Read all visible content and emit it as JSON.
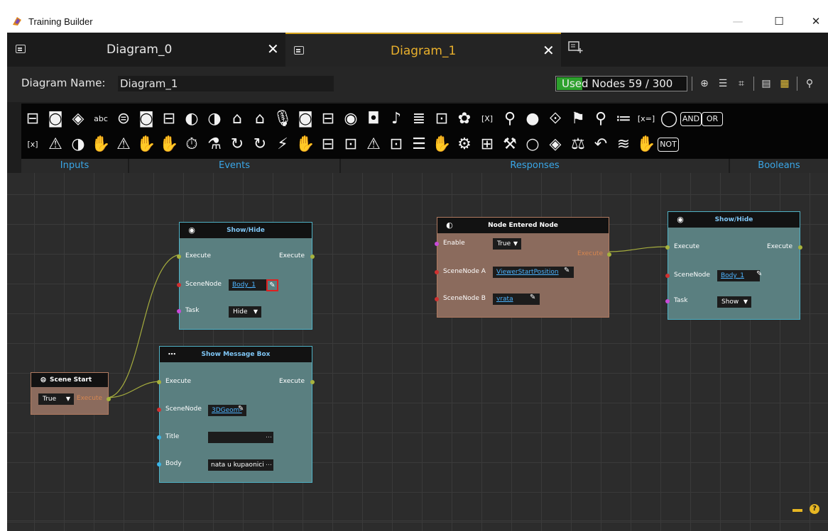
{
  "window": {
    "title": "Training Builder",
    "controls": {
      "minimize": "—",
      "maximize": "☐",
      "close": "✕"
    }
  },
  "tabs": [
    {
      "label": "Diagram_0",
      "close": "✕",
      "active": false
    },
    {
      "label": "Diagram_1",
      "close": "✕",
      "active": true
    }
  ],
  "namebar": {
    "label": "Diagram Name:",
    "value": "Diagram_1",
    "used_nodes": "Used Nodes 59 / 300",
    "used_fraction": 0.197
  },
  "palette": {
    "row1": [
      "⊟",
      "◙",
      "◈",
      "abc",
      "⊜",
      "◙",
      "⊟",
      "◐",
      "◑",
      "⌂",
      "⌂",
      "🎙",
      "◙",
      "⊟",
      "◉",
      "◘",
      "♪",
      "≣",
      "⊡",
      "✿",
      "[X]",
      "⚲",
      "●",
      "⟐",
      "⚑",
      "⚲",
      "≔",
      "[x=]",
      "◯",
      "AND",
      "OR"
    ],
    "row2": [
      "[x]",
      "⚠",
      "◑",
      "✋",
      "⚠",
      "✋",
      "✋",
      "⏱",
      "⚗",
      "↻",
      "↻",
      "⚡",
      "✋",
      "⊟",
      "⊡",
      "⚠",
      "⊡",
      "☰",
      "✋",
      "⚙",
      "⊞",
      "⚒",
      "○",
      "◈",
      "⚖",
      "↶",
      "≋",
      "✋",
      "NOT"
    ],
    "sections": {
      "inputs": "Inputs",
      "events": "Events",
      "responses": "Responses",
      "booleans": "Booleans"
    }
  },
  "nodes": {
    "show_hide_1": {
      "title": "Show/Hide",
      "execute_in": "Execute",
      "execute_out": "Execute",
      "scenenode_label": "SceneNode",
      "scenenode_value": "Body_1",
      "task_label": "Task",
      "task_value": "Hide"
    },
    "show_message": {
      "title": "Show Message Box",
      "execute_in": "Execute",
      "execute_out": "Execute",
      "scenenode_label": "SceneNode",
      "scenenode_value": "3DGeom-",
      "title_label": "Title",
      "title_value": "",
      "body_label": "Body",
      "body_value": "nata u kupaonici"
    },
    "scene_start": {
      "title": "Scene Start",
      "value": "True",
      "execute_out": "Execute"
    },
    "node_entered": {
      "title": "Node Entered Node",
      "enable_label": "Enable",
      "enable_value": "True",
      "execute_out": "Execute",
      "scenenode_a_label": "SceneNode A",
      "scenenode_a_value": "ViewerStartPosition",
      "scenenode_b_label": "SceneNode B",
      "scenenode_b_value": "vrata"
    },
    "show_hide_2": {
      "title": "Show/Hide",
      "execute_in": "Execute",
      "execute_out": "Execute",
      "scenenode_label": "SceneNode",
      "scenenode_value": "Body_1",
      "task_label": "Task",
      "task_value": "Show"
    }
  },
  "help": "?"
}
